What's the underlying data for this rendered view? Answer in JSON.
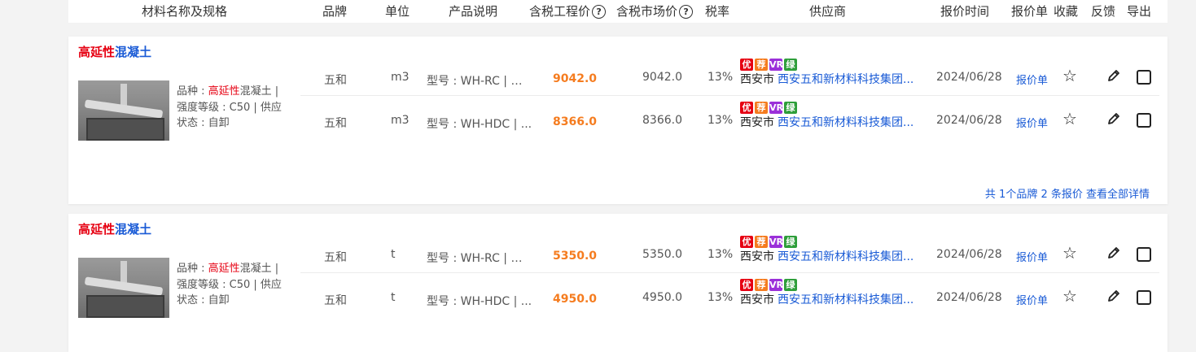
{
  "header": {
    "material": "材料名称及规格",
    "brand": "品牌",
    "unit": "单位",
    "product_desc": "产品说明",
    "eng_price": "含税工程价",
    "mkt_price": "含税市场价",
    "tax": "税率",
    "supplier": "供应商",
    "quote_time": "报价时间",
    "quote_sheet": "报价单",
    "favorite": "收藏",
    "feedback": "反馈",
    "export": "导出",
    "help_glyph": "?"
  },
  "tag_colors": {
    "you": "#e60012",
    "cun": "#f57c1f",
    "vr": "#9b30d9",
    "lv": "#2e9e3a"
  },
  "cards": [
    {
      "title_red": "高延性",
      "title_blue": "混凝土",
      "desc": {
        "kind_label": "品种 : ",
        "kind_hl": "高延性",
        "kind_rest": "混凝土 |",
        "grade": "强度等级 : C50 | 供应",
        "state": "状态 : 自卸"
      },
      "rows": [
        {
          "brand": "五和",
          "unit": "m3",
          "product": "型号 : WH-RC | 用...",
          "eng": "9042.0",
          "mkt": "9042.0",
          "tax": "13%",
          "tags": [
            "优",
            "荐",
            "VR",
            "绿"
          ],
          "city": "西安市",
          "supplier": "西安五和新材料科技集团...",
          "date": "2024/06/28",
          "quote": "报价单"
        },
        {
          "brand": "五和",
          "unit": "m3",
          "product": "型号 : WH-HDC | ...",
          "eng": "8366.0",
          "mkt": "8366.0",
          "tax": "13%",
          "tags": [
            "优",
            "荐",
            "VR",
            "绿"
          ],
          "city": "西安市",
          "supplier": "西安五和新材料科技集团...",
          "date": "2024/06/28",
          "quote": "报价单"
        }
      ],
      "footer": "共 1个品牌 2 条报价 查看全部详情"
    },
    {
      "title_red": "高延性",
      "title_blue": "混凝土",
      "desc": {
        "kind_label": "品种 : ",
        "kind_hl": "高延性",
        "kind_rest": "混凝土 |",
        "grade": "强度等级 : C50 | 供应",
        "state": "状态 : 自卸"
      },
      "rows": [
        {
          "brand": "五和",
          "unit": "t",
          "product": "型号 : WH-RC | 用...",
          "eng": "5350.0",
          "mkt": "5350.0",
          "tax": "13%",
          "tags": [
            "优",
            "荐",
            "VR",
            "绿"
          ],
          "city": "西安市",
          "supplier": "西安五和新材料科技集团...",
          "date": "2024/06/28",
          "quote": "报价单"
        },
        {
          "brand": "五和",
          "unit": "t",
          "product": "型号 : WH-HDC | ...",
          "eng": "4950.0",
          "mkt": "4950.0",
          "tax": "13%",
          "tags": [
            "优",
            "荐",
            "VR",
            "绿"
          ],
          "city": "西安市",
          "supplier": "西安五和新材料科技集团...",
          "date": "2024/06/28",
          "quote": "报价单"
        }
      ]
    }
  ]
}
